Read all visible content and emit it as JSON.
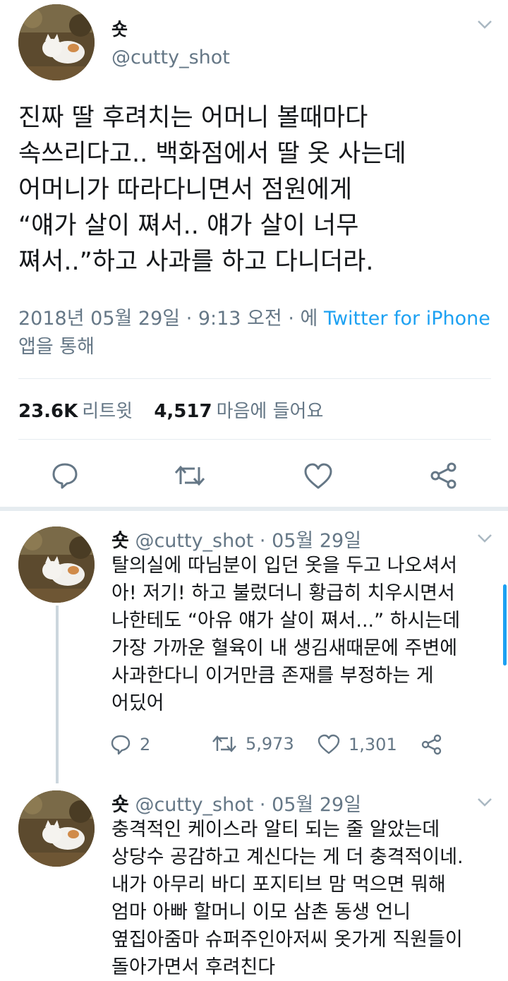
{
  "main_tweet": {
    "name": "숏",
    "handle": "@cutty_shot",
    "text_lines": [
      "진짜 딸 후려치는 어머니 볼때마다",
      "속쓰리다고.. 백화점에서 딸 옷 사는데",
      "어머니가 따라다니면서 점원에게",
      "“얘가 살이 쪄서.. 얘가 살이 너무",
      "쪄서..”하고 사과를 하고 다니더라."
    ],
    "timestamp": "2018년 05월 29일 · 9:13 오전 · 에 ",
    "via_link": "Twitter for iPhone",
    "via_suffix": "앱을 통해",
    "retweets_count": "23.6K",
    "retweets_label": "리트윗",
    "likes_count": "4,517",
    "likes_label": "마음에 들어요",
    "actions": [
      "reply-icon",
      "retweet-icon",
      "like-icon",
      "share-icon"
    ]
  },
  "replies": [
    {
      "name": "숏",
      "handle": "@cutty_shot · 05월 29일",
      "text_lines": [
        "탈의실에 따님분이 입던 옷을 두고 나오셔서",
        "아! 저기! 하고 불렀더니 황급히 치우시면서",
        "나한테도 “아유 얘가 살이 쪄서...” 하시는데",
        "가장 가까운 혈육이 내 생김새때문에 주변에",
        "사과한다니 이거만큼 존재를 부정하는 게",
        "어딨어"
      ],
      "reply_count": "2",
      "retweet_count": "5,973",
      "like_count": "1,301"
    },
    {
      "name": "숏",
      "handle": "@cutty_shot · 05월 29일",
      "text_lines": [
        "충격적인 케이스라 알티 되는 줄 알았는데",
        "상당수 공감하고 계신다는 게 더 충격적이네.",
        "내가 아무리 바디 포지티브 맘 먹으면 뭐해",
        "엄마 아빠 할머니 이모 삼촌 동생 언니",
        "옆집아줌마 슈퍼주인아저씨 옷가게 직원들이",
        "돌아가면서 후려친다"
      ]
    }
  ],
  "colors": {
    "accent": "#1da1f2",
    "muted": "#657786",
    "text": "#14171a",
    "divider": "#e6ecf0"
  }
}
